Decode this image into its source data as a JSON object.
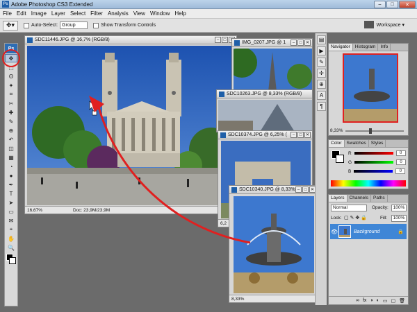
{
  "app": {
    "title": "Adobe Photoshop CS3 Extended",
    "logo": "Ps"
  },
  "window_buttons": {
    "minimize": "–",
    "maximize": "□",
    "close": "✕"
  },
  "menu": [
    "File",
    "Edit",
    "Image",
    "Layer",
    "Select",
    "Filter",
    "Analysis",
    "View",
    "Window",
    "Help"
  ],
  "options_bar": {
    "auto_select_label": "Auto-Select:",
    "auto_select_value": "Group",
    "show_transform_label": "Show Transform Controls",
    "workspace_label": "Workspace ▾"
  },
  "toolbox": {
    "logo": "Ps",
    "tools": [
      "move-tool",
      "marquee-tool",
      "lasso-tool",
      "magic-wand-tool",
      "crop-tool",
      "slice-tool",
      "healing-brush-tool",
      "brush-tool",
      "clone-stamp-tool",
      "history-brush-tool",
      "eraser-tool",
      "gradient-tool",
      "blur-tool",
      "dodge-tool",
      "pen-tool",
      "type-tool",
      "path-selection-tool",
      "shape-tool",
      "notes-tool",
      "eyedropper-tool",
      "hand-tool",
      "zoom-tool"
    ],
    "glyphs": [
      "✥",
      "⬚",
      "ʘ",
      "✦",
      "⌗",
      "✂",
      "✚",
      "✎",
      "⊕",
      "↶",
      "◫",
      "▦",
      "◔",
      "●",
      "✒",
      "T",
      "➤",
      "▭",
      "✉",
      "⌖",
      "✋",
      "🔍"
    ]
  },
  "documents": [
    {
      "title": "SDC11446.JPG @ 16,7% (RGB/8)",
      "zoom": "16,67%",
      "doc": "Doc: 23,9M/23,9M"
    },
    {
      "title": "IMG_0207.JPG @ 1"
    },
    {
      "title": "SDC10263.JPG @ 8,33% (RGB/8)"
    },
    {
      "title": "SDC10374.JPG @ 6,25% (",
      "zoom": "6,2"
    },
    {
      "title": "SDC10340.JPG @ 8,33% (",
      "zoom": "8,33%"
    }
  ],
  "panels": {
    "navigator": {
      "tabs": [
        "Navigator",
        "Histogram",
        "Info"
      ],
      "zoom": "8,33%"
    },
    "color": {
      "tabs": [
        "Color",
        "Swatches",
        "Styles"
      ],
      "channels": [
        {
          "label": "R",
          "value": "0",
          "color": "#e03030"
        },
        {
          "label": "G",
          "value": "0",
          "color": "#30a030"
        },
        {
          "label": "B",
          "value": "0",
          "color": "#3050d0"
        }
      ]
    },
    "layers": {
      "tabs": [
        "Layers",
        "Channels",
        "Paths"
      ],
      "blend_mode": "Normal",
      "opacity_label": "Opacity:",
      "opacity_value": "100%",
      "lock_label": "Lock:",
      "fill_label": "Fill:",
      "fill_value": "100%",
      "layer_name": "Background"
    }
  },
  "colors": {
    "accent_red": "#e02020",
    "selection_blue": "#3f86d6",
    "sky": "#2d62b8"
  }
}
